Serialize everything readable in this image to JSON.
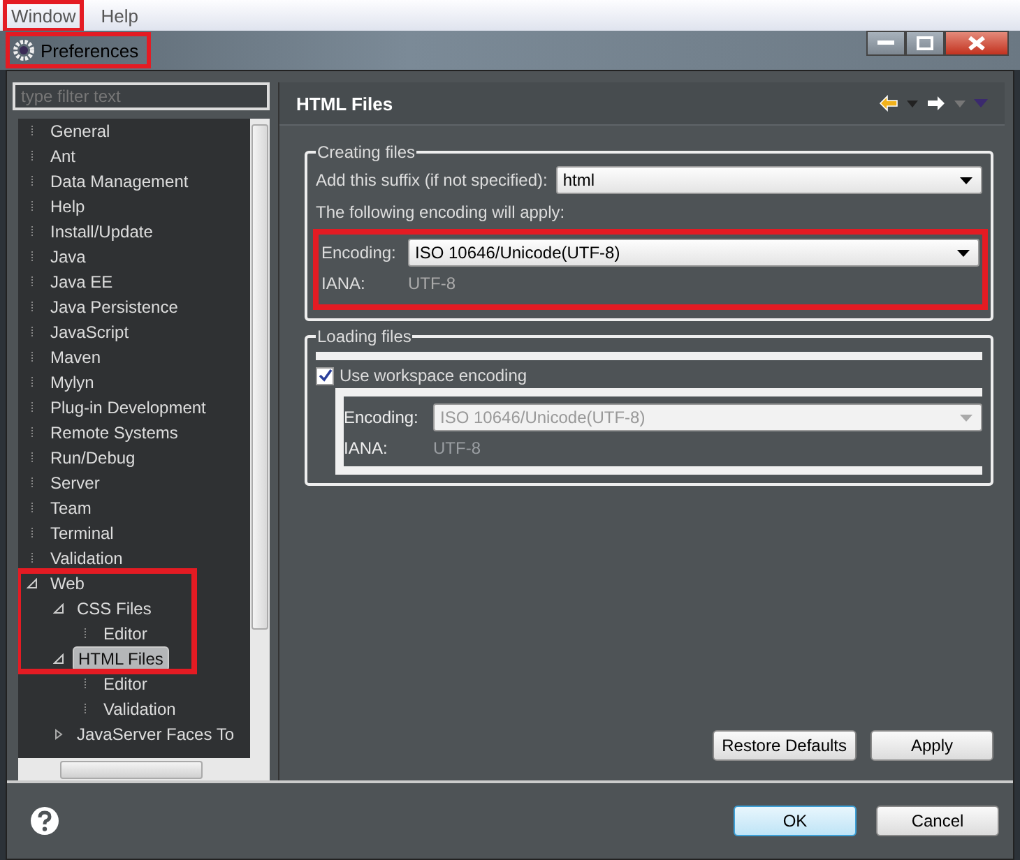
{
  "menu": [
    {
      "label": "Window",
      "highlighted": true
    },
    {
      "label": "Help",
      "highlighted": false
    }
  ],
  "window": {
    "title": "Preferences",
    "highlighted": true
  },
  "filter": {
    "placeholder": "type filter text"
  },
  "tree": [
    {
      "label": "General",
      "selected": false
    },
    {
      "label": "Ant",
      "selected": false
    },
    {
      "label": "Data Management",
      "selected": false
    },
    {
      "label": "Help",
      "selected": false
    },
    {
      "label": "Install/Update",
      "selected": false
    },
    {
      "label": "Java",
      "selected": false
    },
    {
      "label": "Java EE",
      "selected": false
    },
    {
      "label": "Java Persistence",
      "selected": false
    },
    {
      "label": "JavaScript",
      "selected": false
    },
    {
      "label": "Maven",
      "selected": false
    },
    {
      "label": "Mylyn",
      "selected": false
    },
    {
      "label": "Plug-in Development",
      "selected": false
    },
    {
      "label": "Remote Systems",
      "selected": false
    },
    {
      "label": "Run/Debug",
      "selected": false
    },
    {
      "label": "Server",
      "selected": false
    },
    {
      "label": "Team",
      "selected": false
    },
    {
      "label": "Terminal",
      "selected": false
    },
    {
      "label": "Validation",
      "selected": false
    },
    {
      "label": "Web",
      "selected": false,
      "expanded": true,
      "highlighted": true,
      "children": [
        {
          "label": "CSS Files",
          "selected": false,
          "expanded": true,
          "highlighted": true,
          "children": [
            {
              "label": "Editor",
              "selected": false,
              "highlighted": true
            }
          ]
        },
        {
          "label": "HTML Files",
          "selected": true,
          "expanded": true,
          "highlighted": true,
          "children": [
            {
              "label": "Editor",
              "selected": false
            },
            {
              "label": "Validation",
              "selected": false
            }
          ]
        },
        {
          "label": "JavaServer Faces To",
          "selected": false,
          "expanded": false
        }
      ]
    }
  ],
  "page": {
    "title": "HTML Files",
    "creating": {
      "legend": "Creating files",
      "suffix_label": "Add this suffix (if not specified):",
      "suffix_value": "html",
      "note": "The following encoding will apply:",
      "encoding_label": "Encoding:",
      "encoding_value": "ISO 10646/Unicode(UTF-8)",
      "iana_label": "IANA:",
      "iana_value": "UTF-8",
      "highlighted": true
    },
    "loading": {
      "legend": "Loading files",
      "checkbox_label": "Use workspace encoding",
      "checked": true,
      "encoding_label": "Encoding:",
      "encoding_value": "ISO 10646/Unicode(UTF-8)",
      "iana_label": "IANA:",
      "iana_value": "UTF-8"
    },
    "buttons": [
      "Restore Defaults",
      "Apply"
    ]
  },
  "footer": {
    "buttons": [
      {
        "label": "OK",
        "default": true
      },
      {
        "label": "Cancel",
        "default": false
      }
    ]
  }
}
